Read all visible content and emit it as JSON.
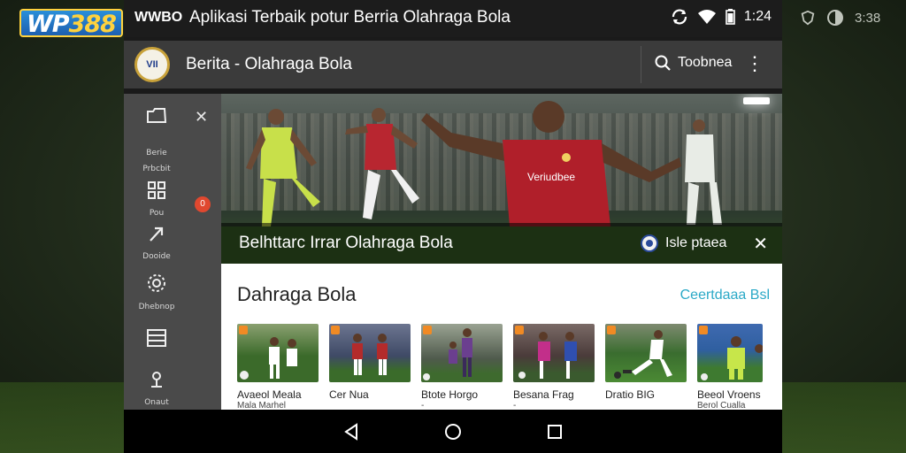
{
  "outer": {
    "logo_wp": "WP",
    "logo_num": "388",
    "time": "3:38"
  },
  "status_bar": {
    "carrier": "WWBO",
    "title": "Aplikasi Terbaik potur Berria Olahraga Bola",
    "time": "1:24"
  },
  "app_bar": {
    "avatar_text": "VII",
    "title": "Berita - Olahraga Bola",
    "search_label": "Toobnea"
  },
  "sidebar": {
    "items": [
      {
        "label": "Berie\nPrbcbit",
        "icon": "folder-icon"
      },
      {
        "label": "Pou",
        "icon": "grid-icon"
      },
      {
        "label": "Dooide",
        "icon": "arrow-icon"
      },
      {
        "label": "Dhebnop",
        "icon": "settings-icon"
      },
      {
        "label": "",
        "icon": "list-icon"
      },
      {
        "label": "Onaut",
        "icon": "pin-icon"
      }
    ],
    "badge": "0"
  },
  "hero": {
    "caption": "Belhttarc Irrar Olahraga Bola",
    "source": "Isle ptaea",
    "jersey_text": "Veriudbee"
  },
  "section": {
    "heading": "Dahraga Bola",
    "see_all": "Ceertdaaa Bsl"
  },
  "cards": [
    {
      "title": "Avaeol Meala",
      "subtitle": "Mala Marhel",
      "colors": [
        "#3b6a2a",
        "#ffffff"
      ]
    },
    {
      "title": "Cer Nua",
      "subtitle": "",
      "colors": [
        "#3f4a66",
        "#b32b2b"
      ]
    },
    {
      "title": "Btote Horgo",
      "subtitle": "-",
      "colors": [
        "#4f5a4c",
        "#6b3f8f"
      ]
    },
    {
      "title": "Besana Frag",
      "subtitle": "-",
      "colors": [
        "#4a3b3a",
        "#c22f8a"
      ]
    },
    {
      "title": "Dratio BIG",
      "subtitle": "",
      "colors": [
        "#3a6d2f",
        "#ffffff"
      ]
    },
    {
      "title": "Beeol Vroens",
      "subtitle": "Berol Cualla",
      "colors": [
        "#2f5fa0",
        "#c7e64a"
      ]
    }
  ]
}
